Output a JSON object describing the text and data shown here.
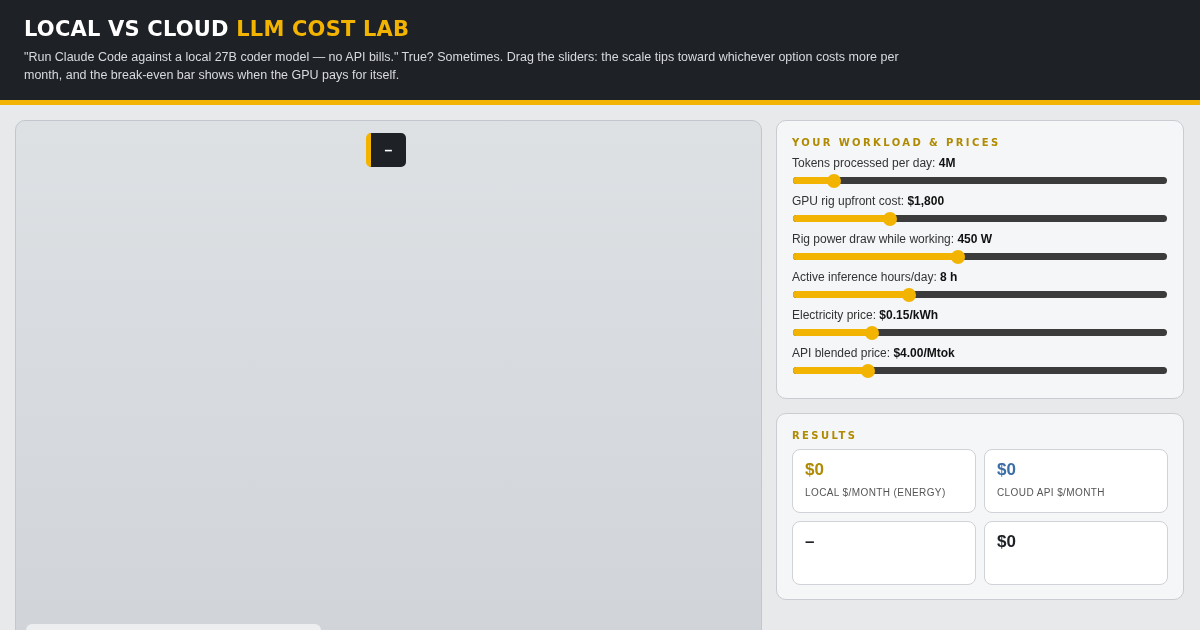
{
  "header": {
    "title": "LOCAL VS CLOUD",
    "title_accent": "LLM COST LAB",
    "description": "\"Run Claude Code against a local 27B coder model — no API bills.\" True? Sometimes. Drag the sliders: the scale tips toward whichever option costs more per month, and the break-even bar shows when the GPU pays for itself."
  },
  "stage": {
    "verdict": "–"
  },
  "workload": {
    "title": "YOUR WORKLOAD & PRICES",
    "sliders": [
      {
        "label": "Tokens processed per day:",
        "value": "4M",
        "level": 0.11
      },
      {
        "label": "GPU rig upfront cost:",
        "value": "$1,800",
        "level": 0.26
      },
      {
        "label": "Rig power draw while working:",
        "value": "450 W",
        "level": 0.44
      },
      {
        "label": "Active inference hours/day:",
        "value": "8 h",
        "level": 0.31
      },
      {
        "label": "Electricity price:",
        "value": "$0.15/kWh",
        "level": 0.21
      },
      {
        "label": "API blended price:",
        "value": "$4.00/Mtok",
        "level": 0.2
      }
    ]
  },
  "results": {
    "title": "RESULTS",
    "cards": [
      {
        "value": "$0",
        "label": "LOCAL $/MONTH (ENERGY)",
        "color": "#b08a00"
      },
      {
        "value": "$0",
        "label": "CLOUD API $/MONTH",
        "color": "#3a6ea5"
      },
      {
        "value": "–",
        "color": "#1e2126"
      },
      {
        "value": "$0",
        "color": "#1e2126"
      }
    ]
  }
}
